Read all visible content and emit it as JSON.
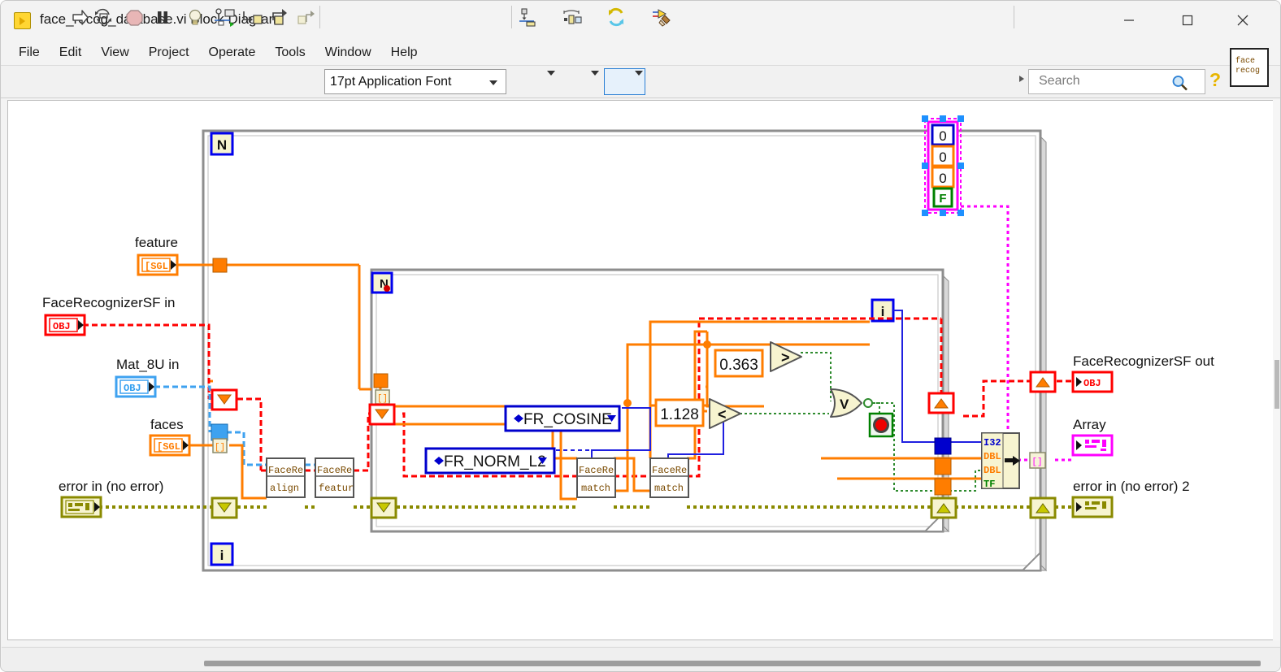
{
  "window": {
    "title": "face_recog_database.vi Block Diagram",
    "app_icon": "labview-vi-icon",
    "minimize": "minimize-icon",
    "maximize": "maximize-icon",
    "close": "close-icon"
  },
  "menubar": {
    "items": [
      "File",
      "Edit",
      "View",
      "Project",
      "Operate",
      "Tools",
      "Window",
      "Help"
    ]
  },
  "toolbar": {
    "icons": [
      "run-arrow-icon",
      "run-continuously-icon",
      "abort-execution-icon",
      "pause-icon",
      "highlight-execution-bulb-icon",
      "retain-wire-values-icon",
      "step-into-icon",
      "step-over-icon",
      "step-out-icon"
    ],
    "font_selector": "17pt Application Font",
    "align_objects": "align-objects-icon",
    "distribute_objects": "distribute-objects-icon",
    "reorder_objects": "reorder-objects-icon",
    "clean_up_diagram": "clean-up-diagram-icon",
    "search_placeholder": "Search",
    "search_icon": "magnifier-icon",
    "help_icon": "help-question-icon",
    "vi_thumbnail_line1": "face",
    "vi_thumbnail_line2": "recog"
  },
  "diagram": {
    "outer_loop": {
      "count_terminal": "N",
      "index_terminal": "i"
    },
    "inner_loop": {
      "count_terminal": "N",
      "index_terminal": "i"
    },
    "controls": [
      {
        "label": "feature",
        "type": "[SGL",
        "color": "#ff7d00"
      },
      {
        "label": "FaceRecognizerSF in",
        "type": "OBJ",
        "color": "#ff0000"
      },
      {
        "label": "Mat_8U in",
        "type": "OBJ",
        "color": "#2f9ef0"
      },
      {
        "label": "faces",
        "type": "[SGL",
        "color": "#ff7d00"
      },
      {
        "label": "error in (no error)",
        "type": "error-cluster",
        "color": "#8a8a00"
      }
    ],
    "indicators": [
      {
        "label": "FaceRecognizerSF out",
        "type": "OBJ",
        "color": "#ff0000"
      },
      {
        "label": "Array",
        "type": "array-cluster",
        "color": "#ff00ff"
      },
      {
        "label": "error in (no error) 2",
        "type": "error-cluster",
        "color": "#8a8a00"
      }
    ],
    "subvis": [
      {
        "top": "FaceRe",
        "bottom": "align"
      },
      {
        "top": "FaceRe",
        "bottom": "featur"
      },
      {
        "top": "FaceRe",
        "bottom": "match"
      },
      {
        "top": "FaceRe",
        "bottom": "match"
      }
    ],
    "enums": [
      {
        "value": "FR_COSINE"
      },
      {
        "value": "FR_NORM_L2"
      }
    ],
    "constants": [
      {
        "value": "1.128",
        "color": "#ff7d00"
      },
      {
        "value": "0.363",
        "color": "#ff7d00"
      }
    ],
    "cluster_constant": {
      "elements": [
        {
          "value": "0",
          "type": "I32",
          "color": "#0000cd"
        },
        {
          "value": "0",
          "type": "DBL",
          "color": "#ff7d00"
        },
        {
          "value": "0",
          "type": "DBL",
          "color": "#ff7d00"
        },
        {
          "value": "F",
          "type": "TF",
          "color": "#008000"
        }
      ],
      "selected": true
    },
    "bundle_node": {
      "inputs": [
        "I32",
        "DBL",
        "DBL",
        "TF"
      ],
      "name": "bundle"
    },
    "comparisons": [
      {
        "symbol": ">",
        "name": "greater-than"
      },
      {
        "symbol": "<",
        "name": "less-than"
      }
    ],
    "boolean_ops": [
      {
        "symbol": "V",
        "name": "or-gate"
      }
    ],
    "stop_terminal": "stop-loop-condition"
  }
}
